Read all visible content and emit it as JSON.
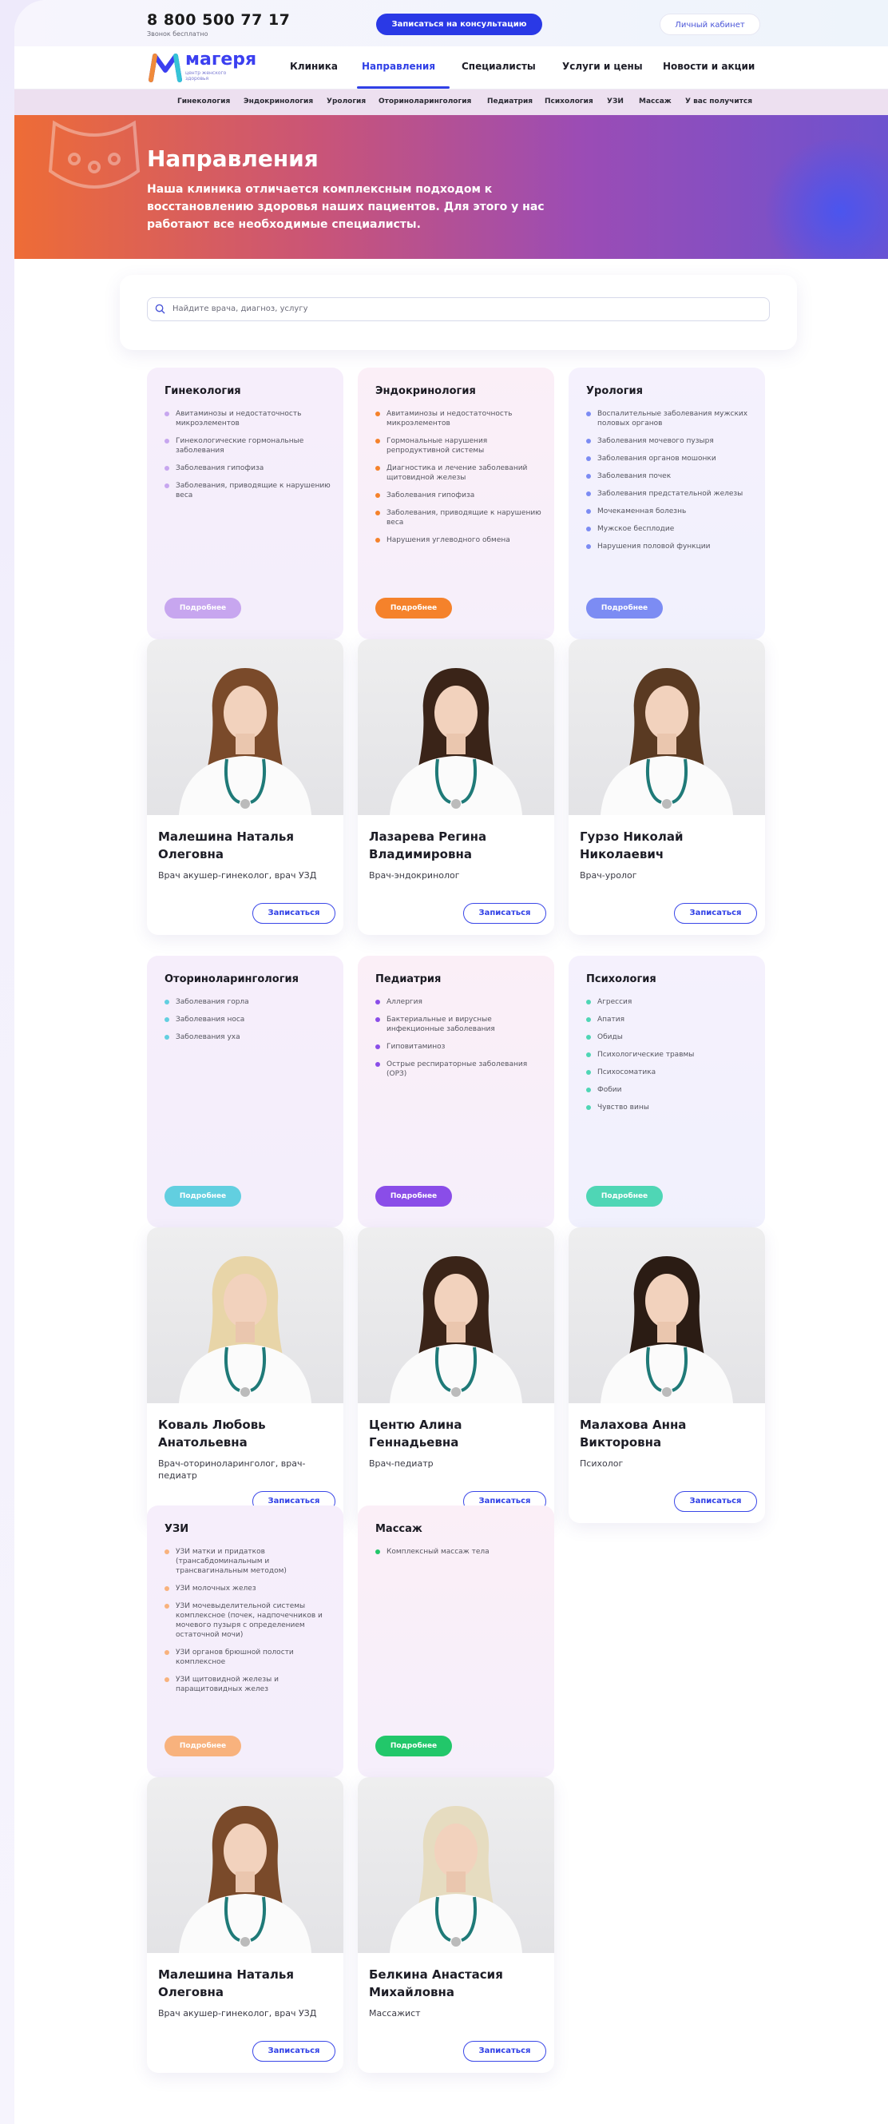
{
  "header": {
    "phone": "8 800 500 77 17",
    "phone_note": "Звонок бесплатно",
    "consult_button": "Записаться на консультацию",
    "cabinet_button": "Личный кабинет"
  },
  "logo": {
    "name": "магеря",
    "tagline": "центр женского здоровья"
  },
  "nav": {
    "items": [
      "Клиника",
      "Направления",
      "Специалисты",
      "Услуги и цены",
      "Новости и акции"
    ],
    "active": "Направления"
  },
  "subnav": [
    "Гинекология",
    "Эндокринология",
    "Урология",
    "Оториноларингология",
    "Педиатрия",
    "Психология",
    "УЗИ",
    "Массаж",
    "У вас получится"
  ],
  "hero": {
    "title": "Направления",
    "text": "Наша клиника отличается комплексным подходом к восстановлению здоровья наших пациентов. Для этого у нас работают все необходимые специалисты."
  },
  "search": {
    "placeholder": "Найдите врача, диагноз, услугу"
  },
  "colors": {
    "accent": "#3040e6",
    "gyn": "#c7a6ef",
    "endo": "#f5822b",
    "uro": "#7c8cf3",
    "ent": "#62cfe0",
    "ped": "#8a4de8",
    "psy": "#4fd6b5",
    "uzi": "#f8b27d",
    "mass": "#22c76a"
  },
  "directions": [
    {
      "title": "Гинекология",
      "more": "Подробнее",
      "items": [
        "Авитаминозы и недостаточность микроэлементов",
        "Гинекологические гормональные заболевания",
        "Заболевания гипофиза",
        "Заболевания, приводящие к нарушению веса"
      ]
    },
    {
      "title": "Эндокринология",
      "more": "Подробнее",
      "items": [
        "Авитаминозы и недостаточность микроэлементов",
        "Гормональные нарушения репродуктивной системы",
        "Диагностика и лечение заболеваний щитовидной железы",
        "Заболевания гипофиза",
        "Заболевания, приводящие к нарушению веса",
        "Нарушения углеводного обмена"
      ]
    },
    {
      "title": "Урология",
      "more": "Подробнее",
      "items": [
        "Воспалительные заболевания мужских половых органов",
        "Заболевания мочевого пузыря",
        "Заболевания органов мошонки",
        "Заболевания почек",
        "Заболевания предстательной железы",
        "Мочекаменная болезнь",
        "Мужское бесплодие",
        "Нарушения половой функции"
      ]
    },
    {
      "title": "Оториноларингология",
      "more": "Подробнее",
      "items": [
        "Заболевания горла",
        "Заболевания носа",
        "Заболевания уха"
      ]
    },
    {
      "title": "Педиатрия",
      "more": "Подробнее",
      "items": [
        "Аллергия",
        "Бактериальные и вирусные инфекционные заболевания",
        "Гиповитаминоз",
        "Острые респираторные заболевания (ОРЗ)"
      ]
    },
    {
      "title": "Психология",
      "more": "Подробнее",
      "items": [
        "Агрессия",
        "Апатия",
        "Обиды",
        "Психологические травмы",
        "Психосоматика",
        "Фобии",
        "Чувство вины"
      ]
    },
    {
      "title": "УЗИ",
      "more": "Подробнее",
      "items": [
        "УЗИ матки и придатков (трансабдоминальным и трансвагинальным методом)",
        "УЗИ молочных желез",
        "УЗИ мочевыделительной системы комплексное (почек, надпочечников и мочевого пузыря с определением остаточной мочи)",
        "УЗИ органов брюшной полости комплексное",
        "УЗИ щитовидной железы и паращитовидных желез"
      ]
    },
    {
      "title": "Массаж",
      "more": "Подробнее",
      "items": [
        "Комплексный массаж тела"
      ]
    }
  ],
  "doctors": [
    {
      "name": "Малешина Наталья Олеговна",
      "role": "Врач акушер-гинеколог, врач УЗД",
      "book": "Записаться"
    },
    {
      "name": "Лазарева Регина Владимировна",
      "role": "Врач-эндокринолог",
      "book": "Записаться"
    },
    {
      "name": "Гурзо Николай Николаевич",
      "role": "Врач-уролог",
      "book": "Записаться"
    },
    {
      "name": "Коваль Любовь Анатольевна",
      "role": "Врач-оториноларинголог, врач-педиатр",
      "book": "Записаться"
    },
    {
      "name": "Центю Алина Геннадьевна",
      "role": "Врач-педиатр",
      "book": "Записаться"
    },
    {
      "name": "Малахова Анна Викторовна",
      "role": "Психолог",
      "book": "Записаться"
    },
    {
      "name": "Малешина Наталья Олеговна",
      "role": "Врач акушер-гинеколог, врач УЗД",
      "book": "Записаться"
    },
    {
      "name": "Белкина Анастасия Михайловна",
      "role": "Массажист",
      "book": "Записаться"
    }
  ]
}
